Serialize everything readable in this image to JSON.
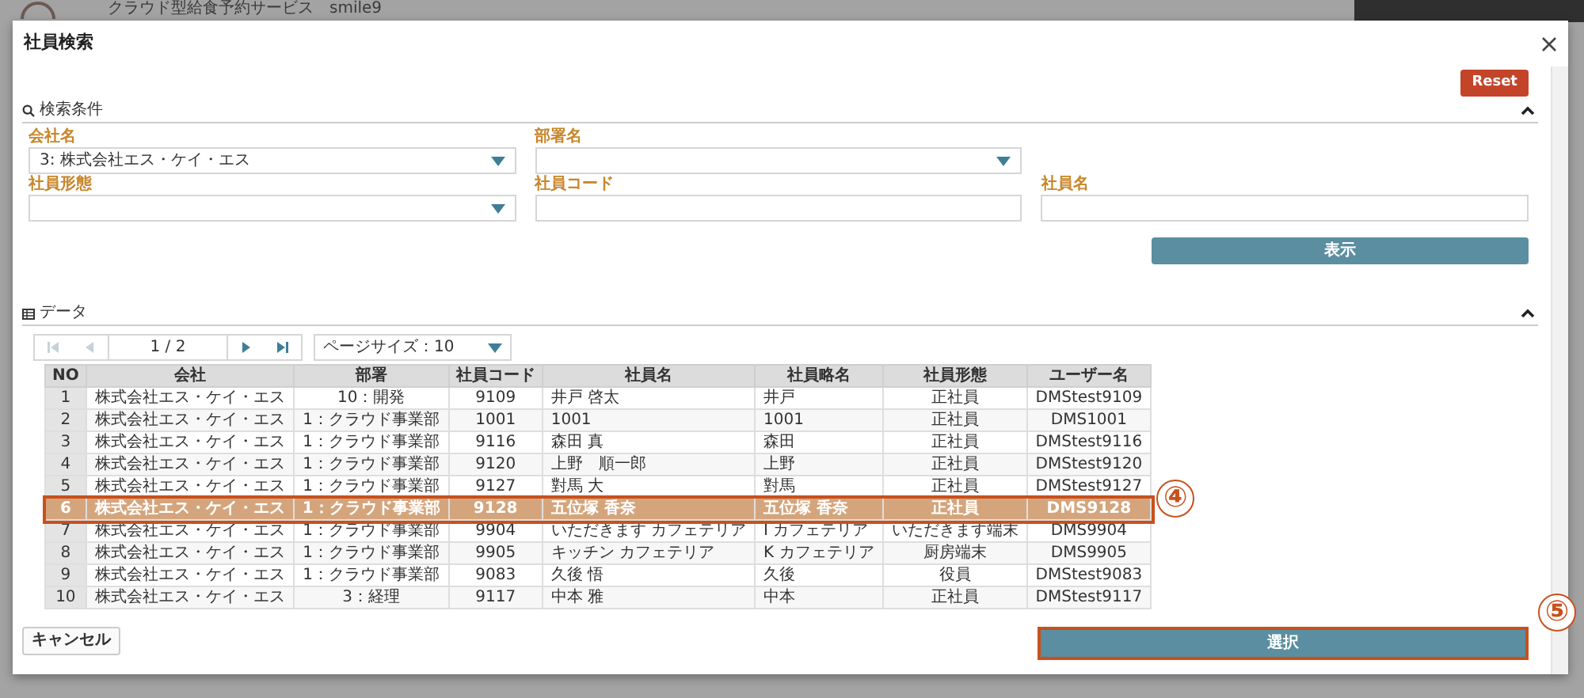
{
  "background_app": {
    "title": "クラウド型給食予約サービス　smile9"
  },
  "dialog": {
    "title": "社員検索",
    "reset_button": "Reset",
    "search_section": {
      "title": "検索条件",
      "expanded": true,
      "fields": [
        {
          "label": "会社名",
          "kind": "select",
          "value": "3: 株式会社エス・ケイ・エス"
        },
        {
          "label": "部署名",
          "kind": "select"
        },
        {
          "kind": "blank"
        },
        {
          "label": "社員形態",
          "kind": "select"
        },
        {
          "label": "社員コード",
          "kind": "input"
        },
        {
          "label": "社員名",
          "kind": "input"
        }
      ],
      "show_button": "表示"
    },
    "data_section": {
      "title": "データ",
      "expanded": true,
      "pager": {
        "page": "1 / 2",
        "first_disabled": true,
        "prev_disabled": true,
        "next_disabled": false,
        "last_disabled": false,
        "page_size": "ページサイズ：10"
      },
      "table": {
        "columns": [
          "NO",
          "会社",
          "部署",
          "社員コード",
          "社員名",
          "社員略名",
          "社員形態",
          "ユーザー名"
        ],
        "rows": [
          {
            "cells": [
              "1",
              "株式会社エス・ケイ・エス",
              "10：開発",
              "9109",
              "井戸 啓太",
              "井戸",
              "正社員",
              "DMStest9109"
            ],
            "selected": false
          },
          {
            "cells": [
              "2",
              "株式会社エス・ケイ・エス",
              "1：クラウド事業部",
              "1001",
              "1001",
              "1001",
              "正社員",
              "DMS1001"
            ],
            "selected": false
          },
          {
            "cells": [
              "3",
              "株式会社エス・ケイ・エス",
              "1：クラウド事業部",
              "9116",
              "森田 真",
              "森田",
              "正社員",
              "DMStest9116"
            ],
            "selected": false
          },
          {
            "cells": [
              "4",
              "株式会社エス・ケイ・エス",
              "1：クラウド事業部",
              "9120",
              "上野　順一郎",
              "上野",
              "正社員",
              "DMStest9120"
            ],
            "selected": false
          },
          {
            "cells": [
              "5",
              "株式会社エス・ケイ・エス",
              "1：クラウド事業部",
              "9127",
              "對馬 大",
              "對馬",
              "正社員",
              "DMStest9127"
            ],
            "selected": false
          },
          {
            "cells": [
              "6",
              "株式会社エス・ケイ・エス",
              "1：クラウド事業部",
              "9128",
              "五位塚 香奈",
              "五位塚 香奈",
              "正社員",
              "DMS9128"
            ],
            "selected": true,
            "callout": "④"
          },
          {
            "cells": [
              "7",
              "株式会社エス・ケイ・エス",
              "1：クラウド事業部",
              "9904",
              "いただきます カフェテリア",
              "I カフェテリア",
              "いただきます端末",
              "DMS9904"
            ],
            "selected": false
          },
          {
            "cells": [
              "8",
              "株式会社エス・ケイ・エス",
              "1：クラウド事業部",
              "9905",
              "キッチン カフェテリア",
              "K カフェテリア",
              "厨房端末",
              "DMS9905"
            ],
            "selected": false
          },
          {
            "cells": [
              "9",
              "株式会社エス・ケイ・エス",
              "1：クラウド事業部",
              "9083",
              "久後 悟",
              "久後",
              "役員",
              "DMStest9083"
            ],
            "selected": false
          },
          {
            "cells": [
              "10",
              "株式会社エス・ケイ・エス",
              "3：経理",
              "9117",
              "中本 雅",
              "中本",
              "正社員",
              "DMStest9117"
            ],
            "selected": false
          }
        ]
      }
    },
    "cancel_button": "キャンセル",
    "select_button": {
      "label": "選択",
      "callout": "⑤"
    }
  }
}
